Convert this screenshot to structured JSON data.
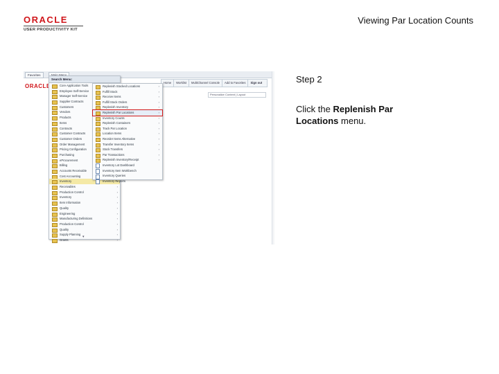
{
  "header": {
    "logo_text": "ORACLE",
    "logo_sub": "USER PRODUCTIVITY KIT",
    "page_title": "Viewing Par Location Counts"
  },
  "screenshot": {
    "topbar_tabs": [
      "Favorites",
      "Main Menu"
    ],
    "brand": "ORACLE",
    "toolbar": [
      "Home",
      "Worklist",
      "MultiChannel Console",
      "Add to Favorites",
      "Sign out"
    ],
    "favorites_field": "Personalize Content | Layout",
    "primary_menu": {
      "title": "Search Menu:",
      "items": [
        "Core Application Tools",
        "Employee Self-Service",
        "Manager Self-Service",
        "Supplier Contracts",
        "Customers",
        "Vendors",
        "Products",
        "Items",
        "Contracts",
        "Customer Contracts",
        "Customer Orders",
        "Order Management",
        "Pricing Configuration",
        "Purchasing",
        "eProcurement",
        "Billing",
        "Accounts Receivable",
        "Cost Accounting",
        "Inventory",
        "Receivables",
        "Production Control",
        "Inventory",
        "Item Information",
        "Quality",
        "Engineering",
        "Manufacturing Definitions",
        "Production Control",
        "Quality",
        "Supply Planning",
        "Grants",
        "Program Management"
      ],
      "active_index": 18
    },
    "secondary_menu": {
      "items": [
        "Replenish Stocked Locations",
        "Fulfill Stock",
        "Receive Items",
        "Fulfill Stock Orders",
        "Replenish Inventory",
        "Replenish Par Locations",
        "Inventory Counts",
        "Replenish Containers",
        "Track Par Location",
        "Location Items",
        "Reorder Items Alternative",
        "Transfer Inventory Items",
        "Stock Transfers",
        "Par Transactions",
        "Replenish Inventory/Receipt",
        "Inventory Lot Dashboard",
        "Inventory Item Workbench",
        "Inventory Queries",
        "Inventory Reports"
      ],
      "highlighted_index": 5,
      "document_item_indices": [
        15,
        16,
        17,
        18
      ]
    }
  },
  "step": {
    "label": "Step 2",
    "instruction_prefix": "Click the ",
    "instruction_bold": "Replenish Par Locations",
    "instruction_suffix": " menu."
  },
  "colors": {
    "oracle_red": "#d0161b",
    "highlight_outline": "#d01818",
    "active_row": "#f4e9a6",
    "folder": "#e7c24f"
  }
}
